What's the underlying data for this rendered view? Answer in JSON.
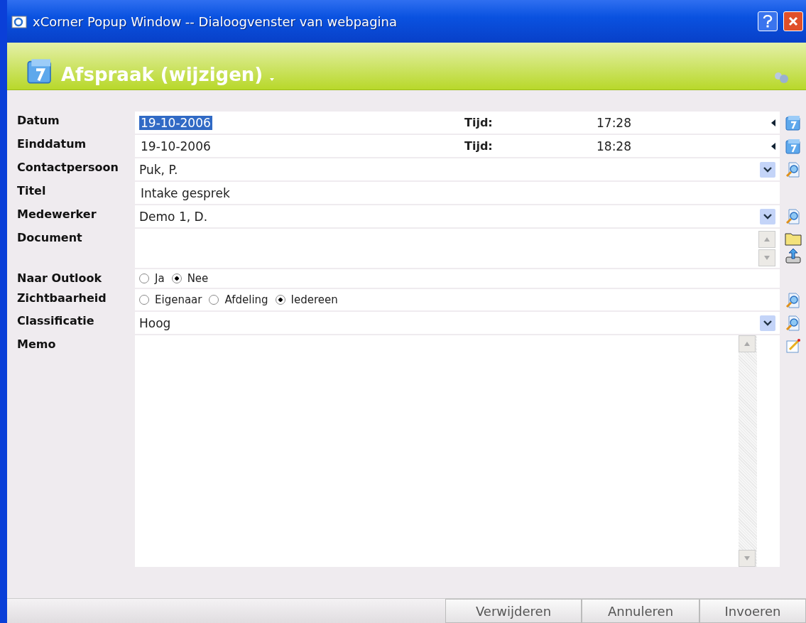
{
  "window": {
    "title": "xCorner Popup Window -- Dialoogvenster van webpagina"
  },
  "header": {
    "title": "Afspraak (wijzigen)"
  },
  "fields": [
    {
      "kind": "date",
      "label": "Datum",
      "value": "19-10-2006",
      "selected": true,
      "time_label": "Tijd:",
      "time": "17:28"
    },
    {
      "kind": "date",
      "label": "Einddatum",
      "value": "19-10-2006",
      "selected": false,
      "time_label": "Tijd:",
      "time": "18:28"
    },
    {
      "kind": "select",
      "label": "Contactpersoon",
      "value": "Puk, P."
    },
    {
      "kind": "text",
      "label": "Titel",
      "value": "Intake gesprek"
    },
    {
      "kind": "select",
      "label": "Medewerker",
      "value": "Demo 1, D."
    },
    {
      "kind": "document",
      "label": "Document"
    },
    {
      "kind": "radio",
      "label": "Naar Outlook",
      "lookup": false,
      "options": [
        {
          "label": "Ja",
          "selected": false
        },
        {
          "label": "Nee",
          "selected": true
        }
      ]
    },
    {
      "kind": "radio",
      "label": "Zichtbaarheid",
      "lookup": true,
      "options": [
        {
          "label": "Eigenaar",
          "selected": false
        },
        {
          "label": "Afdeling",
          "selected": false
        },
        {
          "label": "Iedereen",
          "selected": true
        }
      ]
    },
    {
      "kind": "select",
      "label": "Classificatie",
      "value": "Hoog"
    },
    {
      "kind": "memo",
      "label": "Memo"
    }
  ],
  "buttons": [
    "Verwijderen",
    "Annuleren",
    "Invoeren"
  ]
}
